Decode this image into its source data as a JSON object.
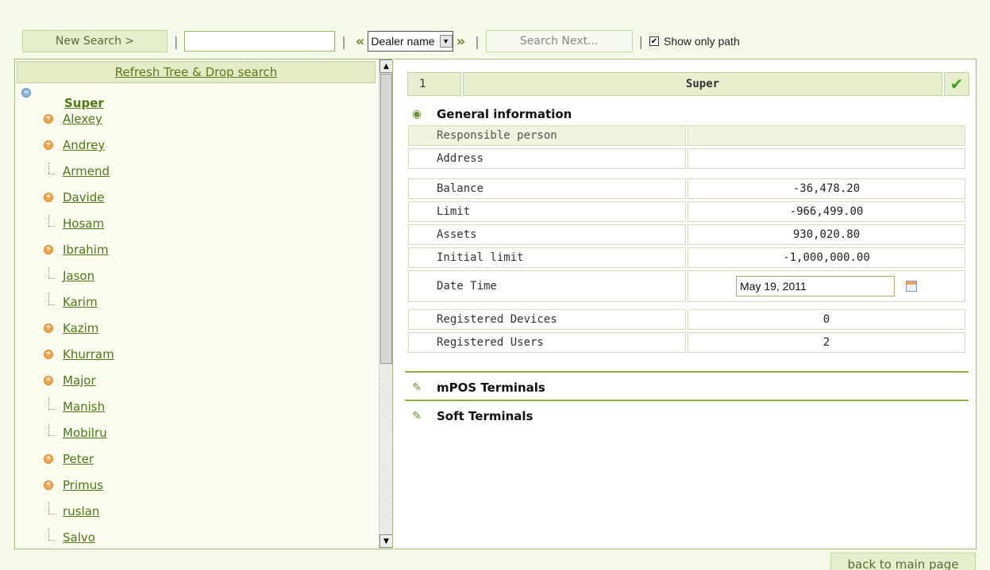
{
  "toolbar": {
    "new_search_label": "New Search >",
    "search_value": "",
    "prev_symbol": "«",
    "next_symbol": "»",
    "filter_select_value": "Dealer name",
    "search_next_label": "Search Next...",
    "show_only_path_label": "Show only path",
    "show_only_path_checked": true
  },
  "tree": {
    "refresh_label": "Refresh Tree & Drop search",
    "root": "Super",
    "items": [
      {
        "label": "Alexey",
        "expandable": true
      },
      {
        "label": "Andrey",
        "expandable": true
      },
      {
        "label": "Armend",
        "expandable": false
      },
      {
        "label": "Davide",
        "expandable": true
      },
      {
        "label": "Hosam",
        "expandable": false
      },
      {
        "label": "Ibrahim",
        "expandable": true
      },
      {
        "label": "Jason",
        "expandable": false
      },
      {
        "label": "Karim",
        "expandable": false
      },
      {
        "label": "Kazim",
        "expandable": true
      },
      {
        "label": "Khurram",
        "expandable": true
      },
      {
        "label": "Major",
        "expandable": true
      },
      {
        "label": "Manish",
        "expandable": false
      },
      {
        "label": "Mobilru",
        "expandable": false
      },
      {
        "label": "Peter",
        "expandable": true
      },
      {
        "label": "Primus",
        "expandable": true
      },
      {
        "label": "ruslan",
        "expandable": false
      },
      {
        "label": "Salvo",
        "expandable": false
      }
    ]
  },
  "detail": {
    "id": "1",
    "name": "Super",
    "general_title": "General information",
    "rows": {
      "responsible": {
        "label": "Responsible person",
        "value": ""
      },
      "address": {
        "label": "Address",
        "value": ""
      },
      "balance": {
        "label": "Balance",
        "value": "-36,478.20"
      },
      "limit": {
        "label": "Limit",
        "value": "-966,499.00"
      },
      "assets": {
        "label": "Assets",
        "value": "930,020.80"
      },
      "initial_limit": {
        "label": "Initial limit",
        "value": "-1,000,000.00"
      },
      "date_time": {
        "label": "Date Time",
        "value": "May 19, 2011"
      },
      "devices": {
        "label": "Registered Devices",
        "value": "0"
      },
      "users": {
        "label": "Registered Users",
        "value": "2"
      }
    },
    "mpos_title": "mPOS Terminals",
    "soft_title": "Soft Terminals"
  },
  "footer": {
    "back_label": "back to main page"
  },
  "colors": {
    "accent": "#8fb23a",
    "link": "#4f7712",
    "panel_bg": "#fbfdf0"
  }
}
